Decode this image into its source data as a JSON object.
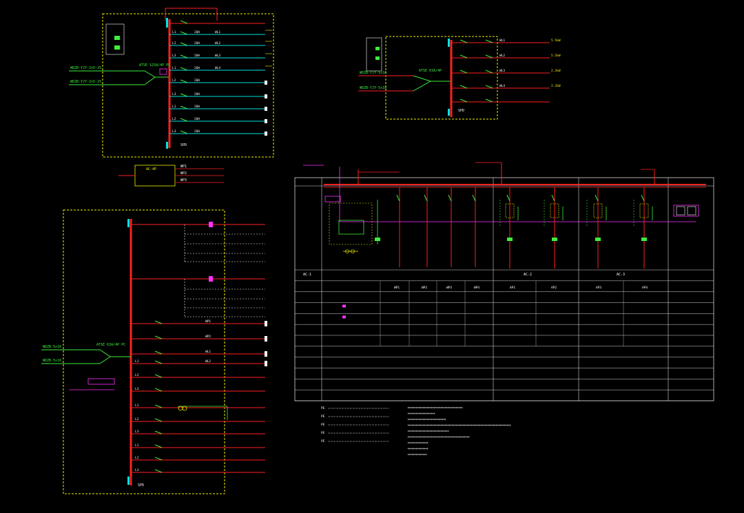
{
  "colors": {
    "background": "#000000",
    "busbar": "#ff2020",
    "panel_frame": "#f2f200",
    "feeder": "#00e5e5",
    "breaker": "#3cf03c",
    "control": "#ff33ff",
    "table_line": "#d8d8d8",
    "text": "#e8e8e8"
  },
  "panel_tl": {
    "incoming_1": "WDZB-YJY-2x5-25",
    "incoming_2": "WDZB-YJY-2x5-25",
    "ats": "ATSE 125A/4P PC",
    "circuits": [
      "L1",
      "L2",
      "L3",
      "L1",
      "L2",
      "L3",
      "L1",
      "L2",
      "L3"
    ],
    "breakers": [
      "20A",
      "20A",
      "20A",
      "20A",
      "20A",
      "20A",
      "20A",
      "20A",
      "20A"
    ],
    "feeders": [
      "WL1",
      "WL2",
      "WL3",
      "WL4"
    ],
    "spd": "SPD"
  },
  "panel_tr": {
    "incoming_1": "WDZB-YJY-5x16",
    "incoming_2": "WDZB-YJY-5x16",
    "ats": "ATSE 63A/4P",
    "feeders": [
      "WL1",
      "WL2",
      "WL3",
      "WL4"
    ],
    "loads": [
      "5.5kW",
      "5.5kW",
      "2.2kW",
      "2.2kW"
    ],
    "spd": "SPD"
  },
  "box_mid": {
    "title": "AC-4P",
    "rows": [
      "WP1",
      "WP2",
      "WP3"
    ]
  },
  "panel_bl": {
    "ats": "ATSE 63A/4P PC",
    "incoming_1": "WDZB-5x16",
    "incoming_2": "WDZB-5x16",
    "rows_top": [
      "WP1",
      "WP2",
      "WL1",
      "WL2"
    ],
    "rows_bottom": [
      "L1",
      "L2",
      "L3",
      "L1",
      "L2",
      "L3",
      "L1",
      "L2",
      "L3"
    ],
    "spd": "SPD"
  },
  "table": {
    "row_count": 12,
    "column_headers": [
      "WP1",
      "WP2",
      "WP3",
      "WP4",
      "AP1",
      "AP2",
      "AP3",
      "AP4"
    ],
    "section_labels": [
      "AC-1",
      "AC-2",
      "AC-3"
    ]
  },
  "notes": {
    "legend": [
      "PE",
      "PE",
      "PE",
      "PE",
      "PE"
    ]
  }
}
